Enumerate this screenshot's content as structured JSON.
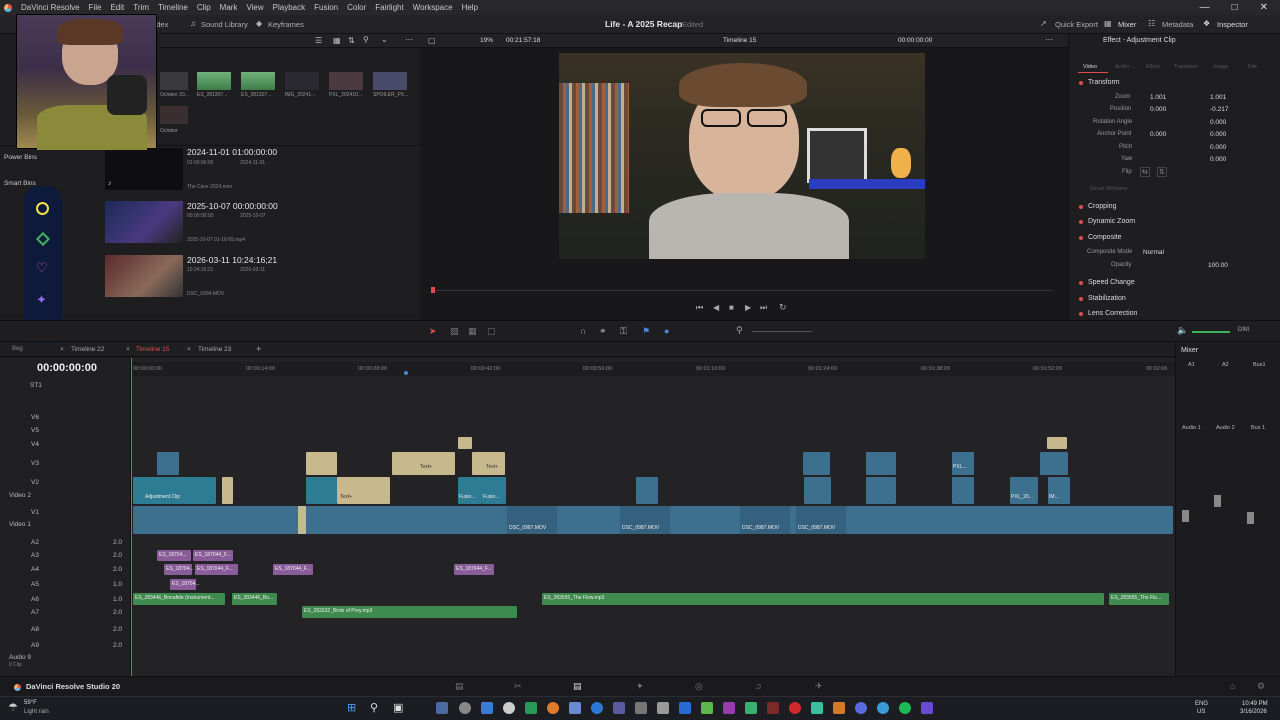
{
  "menubar": {
    "app": "DaVinci Resolve",
    "items": [
      "File",
      "Edit",
      "Trim",
      "Timeline",
      "Clip",
      "Mark",
      "View",
      "Playback",
      "Fusion",
      "Color",
      "Fairlight",
      "Workspace",
      "Help"
    ]
  },
  "toolbar": {
    "index": "Index",
    "sound_library": "Sound Library",
    "keyframes": "Keyframes",
    "project_title": "Life - A 2025 Recap",
    "edited": "Edited",
    "quick_export": "Quick Export",
    "mixer": "Mixer",
    "metadata": "Metadata",
    "inspector": "Inspector"
  },
  "media": {
    "thumb_labels": [
      "October 20...",
      "ES_281307...",
      "ES_281307...",
      "IMG_20241...",
      "PXL_202410...",
      "SPOILER_PX..."
    ],
    "thumb2_label": "October",
    "power_bins": "Power Bins",
    "smart_bins": "Smart Bins",
    "rows": [
      {
        "title": "2024-11-01  01:00:00:00",
        "tc": "01:00:00:00",
        "date": "2024-11-01",
        "file": "The Cave 2024.mov"
      },
      {
        "title": "2025-10-07  00:00:00:00",
        "tc": "00:00:00:00",
        "date": "2025-10-07",
        "file": "2025-10-07 01-16-55.mp4"
      },
      {
        "title": "2026-03-11  10:24:16;21",
        "tc": "10:24:16;21",
        "date": "2026-03-11",
        "file": "DSC_0994.MOV"
      }
    ]
  },
  "viewer": {
    "zoom": "19%",
    "timecode": "00:21:57:18",
    "timeline_name": "Timeline 15",
    "tc_right": "00:00:00:00"
  },
  "inspector": {
    "title": "Effect - Adjustment Clip",
    "tabs": [
      "Video",
      "Audio",
      "Effect",
      "Transition",
      "Image",
      "File"
    ],
    "transform": "Transform",
    "zoom_label": "Zoom",
    "zoom_x": "1.001",
    "zoom_y": "1.001",
    "position_label": "Position",
    "pos_x": "0.000",
    "pos_y": "-0.217",
    "rotation_label": "Rotation Angle",
    "rotation": "0.000",
    "anchor_label": "Anchor Point",
    "anchor_x": "0.000",
    "anchor_y": "0.000",
    "pitch_label": "Pitch",
    "pitch": "0.000",
    "yaw_label": "Yaw",
    "yaw": "0.000",
    "flip_label": "Flip",
    "smart_reframe": "Smart Reframe",
    "sections": [
      "Cropping",
      "Dynamic Zoom",
      "Composite",
      "Speed Change",
      "Stabilization",
      "Lens Correction"
    ],
    "composite_mode_label": "Composite Mode",
    "composite_mode": "Normal",
    "opacity_label": "Opacity",
    "opacity": "100.00"
  },
  "timeline": {
    "tabs": [
      "Timeline 22",
      "Timeline 15",
      "Timeline 23"
    ],
    "bin_tab": "Beg",
    "timecode": "00:00:00:00",
    "ruler": [
      "00:00:00:00",
      "00:00:14:00",
      "00:00:28:00",
      "00:00:42:00",
      "00:00:56:00",
      "00:01:10:00",
      "00:01:24:00",
      "00:01:38:00",
      "00:01:52:00",
      "00:02:06"
    ],
    "tracks_video": [
      "V6",
      "V5",
      "V4",
      "V3",
      "V2",
      "V1"
    ],
    "video2": "Video 2",
    "video1": "Video 1",
    "tracks_audio": [
      "A2",
      "A3",
      "A4",
      "A5",
      "A6",
      "A7",
      "A8",
      "A9"
    ],
    "audio_vals": [
      "2.0",
      "2.0",
      "2.0",
      "1.0",
      "1.0",
      "2.0",
      "2.0",
      "2.0"
    ],
    "audio9": "Audio 9",
    "audio9_sub": "0 Clip",
    "st1": "ST1",
    "clips": {
      "adjustment": "Adjustment Clip",
      "dsc": "DSC_0987.MOV",
      "a_187044": "ES_187044_F...",
      "a_187044b": "ES_18704...",
      "a_283446": "ES_283446_Bonafide (Instrument...",
      "a_283446b": "ES_283446_Bo...",
      "a_283332": "ES_283332_Birds of Prey.mp3",
      "a_283555": "ES_283555_The Flow.mp3",
      "a_283555b": "ES_283555_The Flo...",
      "text": "Text+",
      "fusion": "Fusio...",
      "pxl": "PXL...",
      "pxl2": "PXL_20...",
      "im": "IM..."
    }
  },
  "mixer": {
    "title": "Mixer",
    "channels": [
      "A1",
      "A2",
      "Bus1"
    ],
    "names": [
      "Audio 1",
      "Audio 2",
      "Bus 1"
    ],
    "dim": "DIM"
  },
  "bottom": {
    "app_name": "DaVinci Resolve Studio 20"
  },
  "taskbar": {
    "weather_temp": "59°F",
    "weather_desc": "Light rain",
    "lang1": "ENG",
    "lang2": "US",
    "time": "10:49 PM",
    "date": "3/16/2026"
  },
  "colors": {
    "accent_red": "#e04d4d",
    "clip_blue": "#3d6f8f",
    "clip_teal": "#2d7c93",
    "audio_purple": "#8a5d9a",
    "audio_green": "#3f8b4f",
    "title_tan": "#c7b98d"
  }
}
